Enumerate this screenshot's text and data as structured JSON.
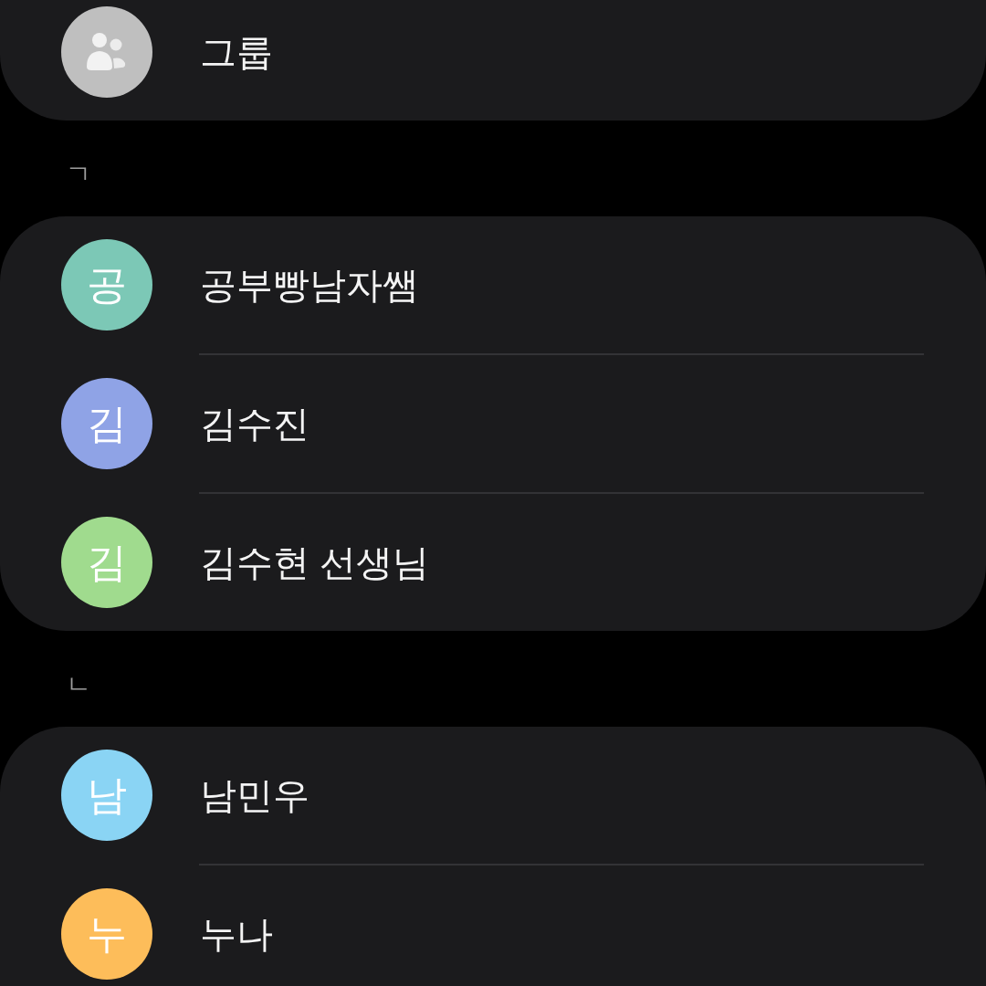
{
  "sections": [
    {
      "items": [
        {
          "kind": "group",
          "name": "그룹",
          "color": "#bfbfbf"
        }
      ]
    },
    {
      "header": "ㄱ",
      "items": [
        {
          "kind": "contact",
          "initial": "공",
          "name": "공부빵남자쌤",
          "color": "#7cc8b6"
        },
        {
          "kind": "contact",
          "initial": "김",
          "name": "김수진",
          "color": "#8fa3e6"
        },
        {
          "kind": "contact",
          "initial": "김",
          "name": "김수현 선생님",
          "color": "#a0db8e"
        }
      ]
    },
    {
      "header": "ㄴ",
      "items": [
        {
          "kind": "contact",
          "initial": "남",
          "name": "남민우",
          "color": "#8ad4f4"
        },
        {
          "kind": "contact",
          "initial": "누",
          "name": "누나",
          "color": "#fdbd5a"
        }
      ]
    }
  ]
}
